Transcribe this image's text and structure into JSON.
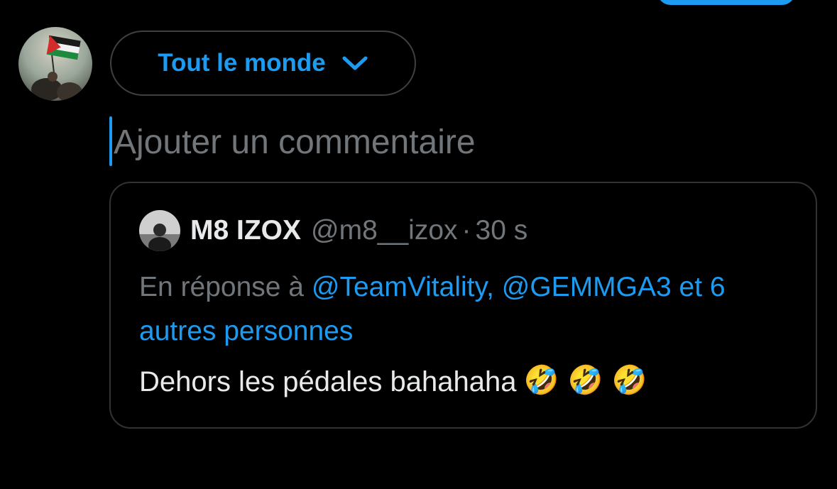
{
  "audience": {
    "label": "Tout le monde",
    "icon": "chevron-down-icon"
  },
  "composer": {
    "placeholder": "Ajouter un commentaire"
  },
  "quoted_tweet": {
    "author_name": "M8 IZOX",
    "author_handle": "@m8__izox",
    "separator": "·",
    "time": "30 s",
    "reply_prefix": "En réponse à",
    "reply_mentions": "@TeamVitality, @GEMMGA3 et 6 autres personnes",
    "text": "Dehors les pédales bahahaha",
    "emojis": [
      "🤣",
      "🤣",
      "🤣"
    ]
  },
  "colors": {
    "background": "#000000",
    "accent": "#1d9bf0",
    "muted": "#71767b",
    "text": "#e7e9ea",
    "border": "#2f3336"
  }
}
